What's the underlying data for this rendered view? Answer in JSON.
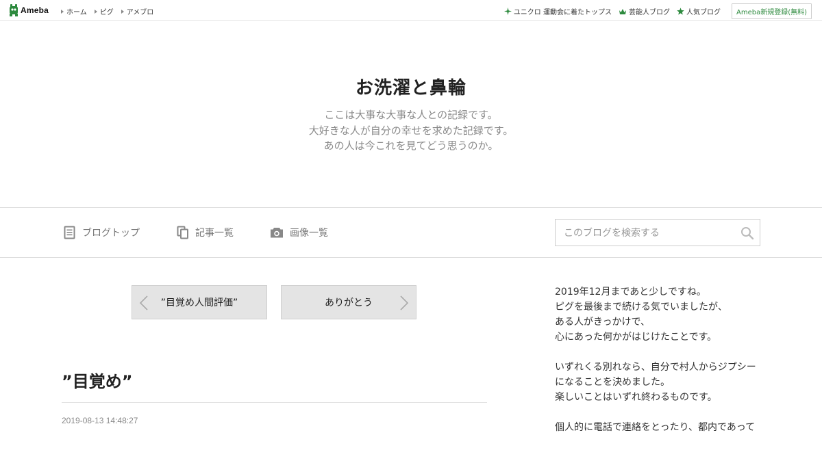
{
  "topbar": {
    "logo_text": "Ameba",
    "nav": [
      "ホーム",
      "ピグ",
      "アメブロ"
    ],
    "links": [
      {
        "icon": "sparkle-icon",
        "label": "ユニクロ 運動会に着たトップス"
      },
      {
        "icon": "crown-icon",
        "label": "芸能人ブログ"
      },
      {
        "icon": "star-icon",
        "label": "人気ブログ"
      }
    ],
    "register_label": "Ameba新規登録(無料)",
    "accent_color": "#2d8a3e"
  },
  "blog": {
    "title": "お洗濯と鼻輪",
    "description": [
      "ここは大事な大事な人との記録です。",
      "大好きな人が自分の幸せを求めた記録です。",
      "あの人は今これを見てどう思うのか。"
    ]
  },
  "blognav": {
    "items": [
      {
        "icon": "document-icon",
        "label": "ブログトップ"
      },
      {
        "icon": "copy-icon",
        "label": "記事一覧"
      },
      {
        "icon": "camera-icon",
        "label": "画像一覧"
      }
    ],
    "search_placeholder": "このブログを検索する"
  },
  "pager": {
    "prev_label": "”目覚め人間評価”",
    "next_label": "ありがとう"
  },
  "article": {
    "title": "”目覚め”",
    "date": "2019-08-13 14:48:27"
  },
  "sidebar": {
    "paragraphs": [
      [
        "2019年12月まであと少しですね。",
        "ピグを最後まで続ける気でいましたが、",
        "ある人がきっかけで、",
        "心にあった何かがはじけたことです。"
      ],
      [
        "いずれくる別れなら、自分で村人からジプシー",
        "になることを決めました。",
        "楽しいことはいずれ終わるものです。"
      ],
      [
        "個人的に電話で連絡をとったり、都内であって"
      ]
    ]
  }
}
